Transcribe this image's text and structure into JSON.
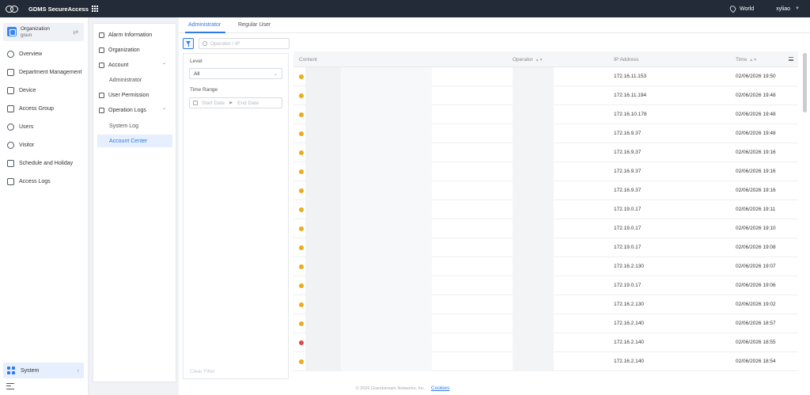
{
  "topbar": {
    "app_title": "GDMS SecureAccess",
    "region": "World",
    "user": "xyliao"
  },
  "org": {
    "label": "Organization",
    "value": "gsun"
  },
  "nav": {
    "items": [
      {
        "label": "Overview",
        "icon": "overview-icon"
      },
      {
        "label": "Department Management",
        "icon": "department-icon"
      },
      {
        "label": "Device",
        "icon": "device-icon"
      },
      {
        "label": "Access Group",
        "icon": "access-group-icon"
      },
      {
        "label": "Users",
        "icon": "users-icon"
      },
      {
        "label": "Visitor",
        "icon": "visitor-icon"
      },
      {
        "label": "Schedule and Holiday",
        "icon": "calendar-icon"
      },
      {
        "label": "Access Logs",
        "icon": "logs-icon"
      }
    ],
    "system": "System"
  },
  "subnav": {
    "alarm": "Alarm Information",
    "organization": "Organization",
    "account": "Account",
    "administrator": "Administrator",
    "user_permission": "User Permission",
    "operation_logs": "Operation Logs",
    "system_log": "System Log",
    "account_center": "Account Center"
  },
  "tabs": [
    "Administrator",
    "Regular User"
  ],
  "search": {
    "placeholder": "Operator / IP"
  },
  "filter": {
    "level_label": "Level",
    "level_value": "All",
    "time_label": "Time Range",
    "start_placeholder": "Start Date",
    "end_placeholder": "End Date",
    "clear": "Clear Filter"
  },
  "table": {
    "columns": [
      "Content",
      "Operator",
      "IP Address",
      "Time"
    ],
    "rows": [
      {
        "level": "warning",
        "ip": "172.16.11.153",
        "time": "02/06/2026 19:50"
      },
      {
        "level": "warning",
        "ip": "172.16.11.194",
        "time": "02/06/2026 19:48"
      },
      {
        "level": "warning",
        "ip": "172.16.10.178",
        "time": "02/06/2026 19:48"
      },
      {
        "level": "warning",
        "ip": "172.16.9.37",
        "time": "02/06/2026 19:48"
      },
      {
        "level": "warning",
        "ip": "172.16.9.37",
        "time": "02/06/2026 19:16"
      },
      {
        "level": "warning",
        "ip": "172.16.9.37",
        "time": "02/06/2026 19:16"
      },
      {
        "level": "warning",
        "ip": "172.16.9.37",
        "time": "02/06/2026 19:16"
      },
      {
        "level": "warning",
        "ip": "172.19.0.17",
        "time": "02/06/2026 19:11"
      },
      {
        "level": "warning",
        "ip": "172.19.0.17",
        "time": "02/06/2026 19:10"
      },
      {
        "level": "warning",
        "ip": "172.19.0.17",
        "time": "02/06/2026 19:08"
      },
      {
        "level": "warning",
        "ip": "172.16.2.130",
        "time": "02/06/2026 19:07"
      },
      {
        "level": "warning",
        "ip": "172.19.0.17",
        "time": "02/06/2026 19:06"
      },
      {
        "level": "warning",
        "ip": "172.16.2.130",
        "time": "02/06/2026 19:02"
      },
      {
        "level": "warning",
        "ip": "172.16.2.140",
        "time": "02/06/2026 18:57"
      },
      {
        "level": "error",
        "ip": "172.16.2.140",
        "time": "02/06/2026 18:55"
      },
      {
        "level": "warning",
        "ip": "172.16.2.140",
        "time": "02/06/2026 18:54"
      }
    ]
  },
  "footer": {
    "copyright": "© 2026 Grandstream Networks, Inc.",
    "cookies": "Cookies"
  },
  "colors": {
    "topbar": "#232b38",
    "accent": "#2f7ae5",
    "warning": "#f0a91a",
    "error": "#e54545"
  }
}
